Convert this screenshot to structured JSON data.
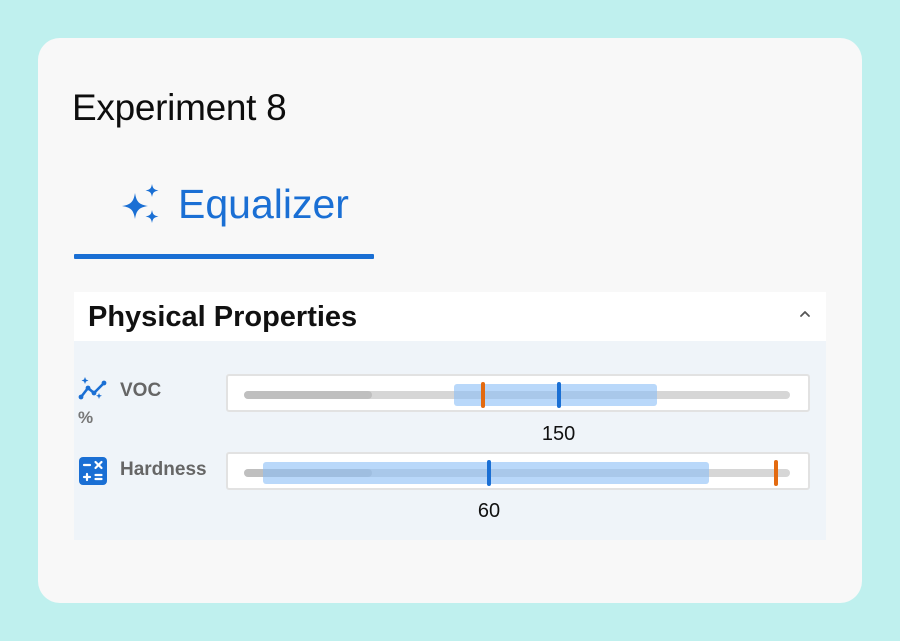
{
  "panel": {
    "title": "Experiment 8"
  },
  "tab": {
    "icon": "sparkles-icon",
    "label": "Equalizer"
  },
  "section": {
    "title": "Physical Properties",
    "state": "expanded",
    "chevron_icon": "chevron-up-icon"
  },
  "properties": [
    {
      "name": "VOC",
      "unit": "%",
      "icon": "trend-line-icon",
      "value_label": "150",
      "fill_fraction": 0.22,
      "range_fraction": [
        0.39,
        0.74
      ],
      "value_fraction": 0.57,
      "reference_fraction": 0.44
    },
    {
      "name": "Hardness",
      "unit": "",
      "icon": "calculator-icon",
      "value_label": "60",
      "fill_fraction": 0.22,
      "range_fraction": [
        0.06,
        0.83
      ],
      "value_fraction": 0.45,
      "reference_fraction": 1.0
    }
  ],
  "colors": {
    "background": "#bff0ee",
    "card": "#f8f8f8",
    "accent": "#1a6fd4",
    "reference_marker": "#e36a10",
    "range_fill": "#8abef7",
    "section_body": "#eff4f9"
  }
}
